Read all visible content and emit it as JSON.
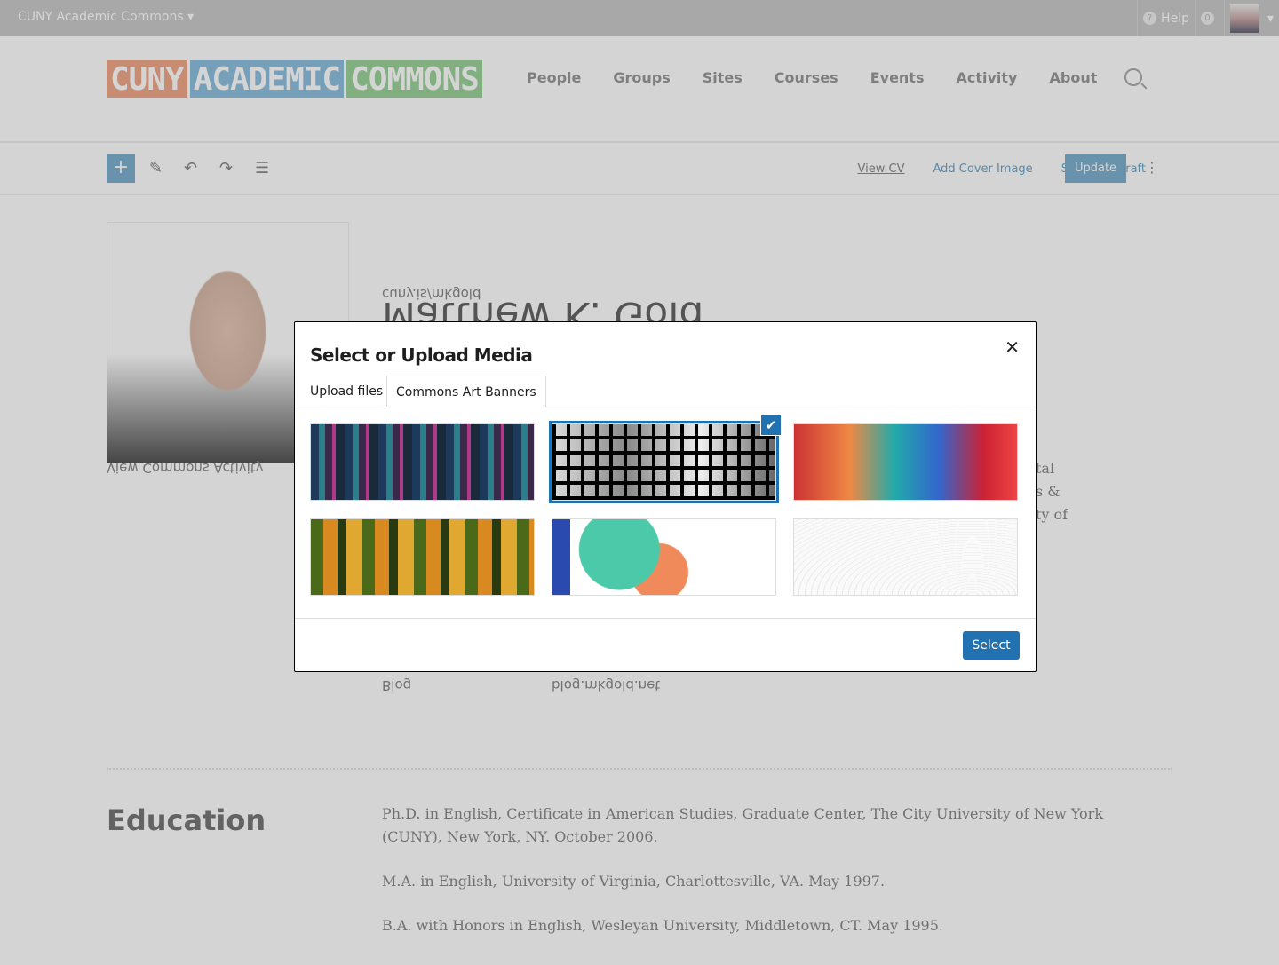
{
  "adminbar": {
    "site": "CUNY Academic Commons",
    "help": "Help",
    "notifications": "0"
  },
  "logo": {
    "text": [
      "CUNY",
      "ACADEMIC",
      "COMMONS"
    ]
  },
  "nav": [
    "People",
    "Groups",
    "Sites",
    "Courses",
    "Events",
    "Activity",
    "About"
  ],
  "toolbar": {
    "view_cv": "View CV",
    "add_cover": "Add Cover Image",
    "switch_draft": "Switch to draft",
    "update": "Update"
  },
  "profile": {
    "name": "Matthew K. Gold",
    "url": "cuny.is/mkgold",
    "activity": "View Commons Activity",
    "blog_label": "Blog",
    "blog_url": "blog.mkgold.net",
    "partial": [
      "tal",
      "s &",
      "ty of"
    ]
  },
  "education": {
    "heading": "Education",
    "items": [
      "Ph.D. in English, Certificate in American Studies, Graduate Center, The City University of New York (CUNY), New York, NY. October 2006.",
      "M.A. in English, University of Virginia, Charlottesville, VA. May 1997.",
      "B.A. with Honors in English, Wesleyan University, Middletown, CT. May 1995."
    ]
  },
  "modal": {
    "title": "Select or Upload Media",
    "tabs": [
      "Upload files",
      "Commons Art Banners"
    ],
    "active_tab": 1,
    "selected_index": 1,
    "select_label": "Select",
    "accent": "#2271b1"
  }
}
